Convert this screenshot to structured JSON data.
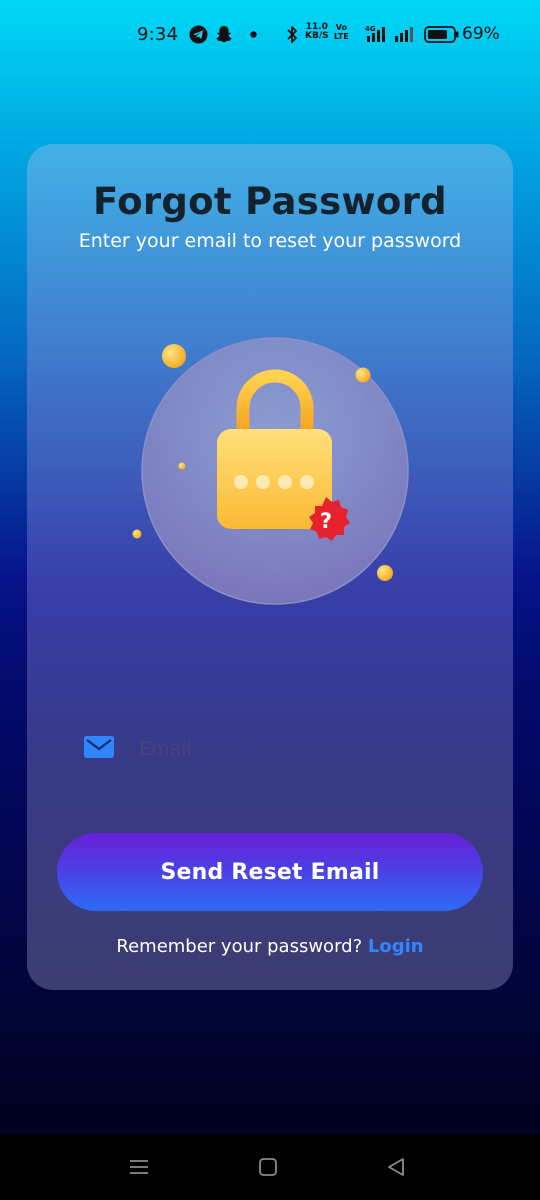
{
  "status_bar": {
    "time": "9:34",
    "network_speed_value": "11.0",
    "network_speed_unit": "KB/S",
    "volte_top": "Vo",
    "volte_bottom": "LTE",
    "battery_percent": "69%"
  },
  "form": {
    "title": "Forgot Password",
    "subtitle": "Enter your email to reset your password",
    "email_placeholder": "Email",
    "email_value": "",
    "submit_label": "Send Reset Email",
    "remember_text": "Remember your password?",
    "login_link": "Login"
  },
  "colors": {
    "accent": "#2f86ff",
    "button_top": "#6a1fd6",
    "button_bottom": "#2c6cf7",
    "lock_body": "#fec94a",
    "badge": "#e8212f"
  },
  "icons": {
    "status": [
      "telegram-icon",
      "snapchat-icon",
      "dot-icon",
      "bluetooth-icon",
      "signal-icon",
      "battery-icon"
    ],
    "email": "envelope-icon",
    "illustration": "lock-icon",
    "nav": [
      "menu-icon",
      "home-icon",
      "back-icon"
    ]
  }
}
